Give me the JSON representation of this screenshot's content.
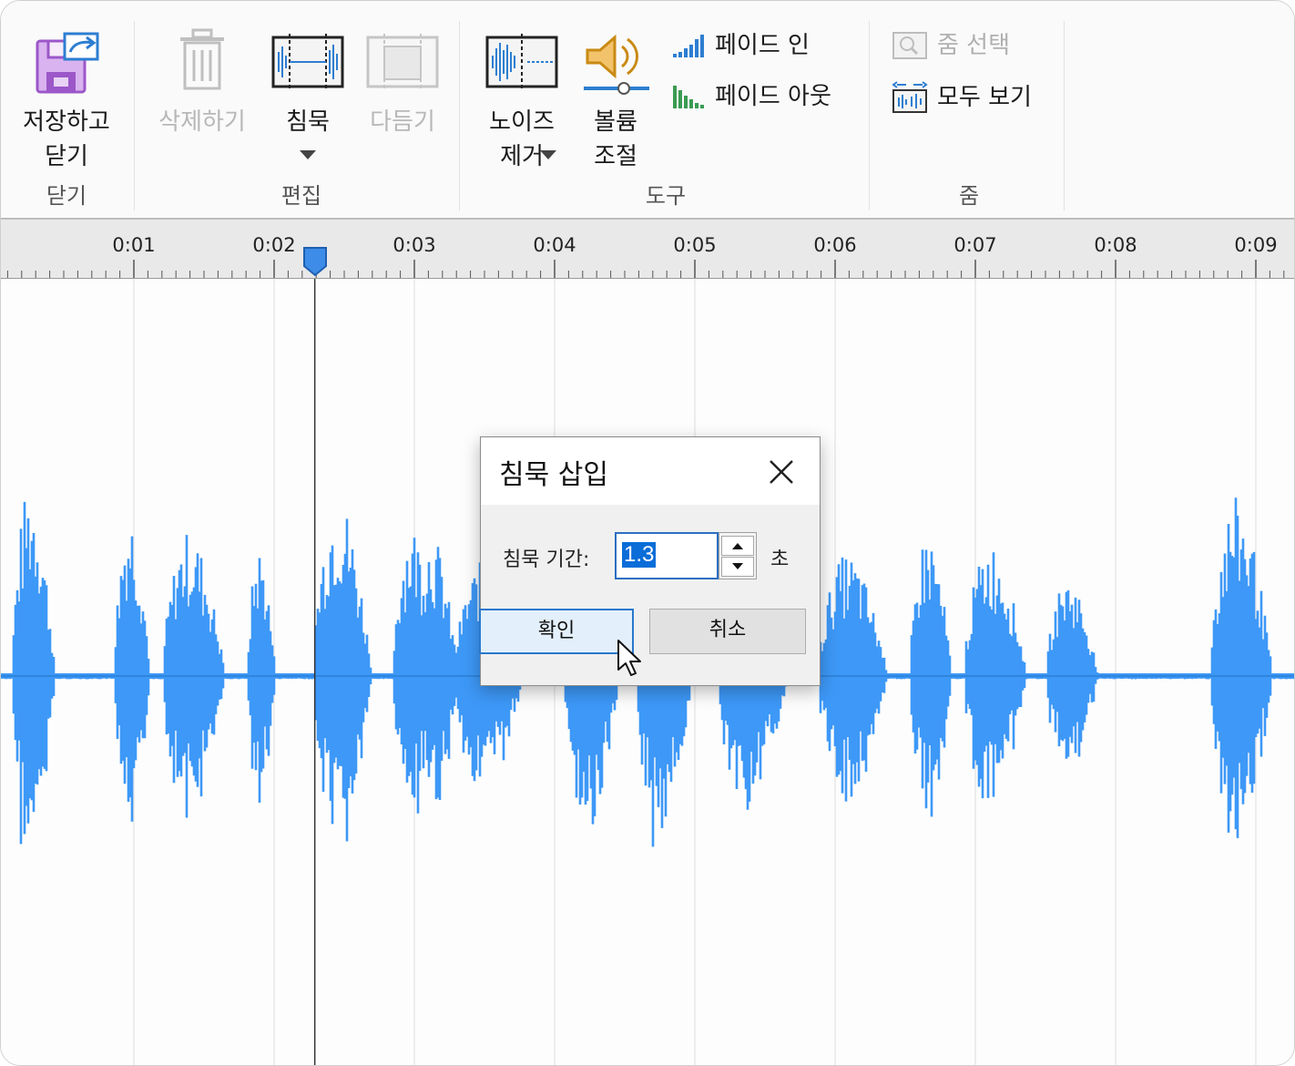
{
  "ribbon": {
    "groups": [
      {
        "label": "닫기"
      },
      {
        "label": "편집"
      },
      {
        "label": "도구"
      },
      {
        "label": "줌"
      }
    ],
    "buttons": {
      "save_close": {
        "label": "저장하고\n닫기",
        "icon": "save-close-icon",
        "enabled": true
      },
      "delete": {
        "label": "삭제하기",
        "icon": "trash-icon",
        "enabled": false
      },
      "silence": {
        "label": "침묵",
        "icon": "insert-silence-icon",
        "enabled": true,
        "has_dropdown": true
      },
      "trim": {
        "label": "다듬기",
        "icon": "trim-icon",
        "enabled": false
      },
      "noise": {
        "label": "노이즈\n제거",
        "icon": "noise-removal-icon",
        "enabled": true,
        "has_dropdown": true
      },
      "volume": {
        "label": "볼륨\n조절",
        "icon": "speaker-volume-icon",
        "enabled": true
      },
      "fade_in": {
        "label": "페이드 인",
        "icon": "fade-in-icon",
        "enabled": true
      },
      "fade_out": {
        "label": "페이드 아웃",
        "icon": "fade-out-icon",
        "enabled": true
      },
      "zoom_selection": {
        "label": "줌 선택",
        "icon": "zoom-selection-icon",
        "enabled": false
      },
      "view_all": {
        "label": "모두 보기",
        "icon": "view-all-icon",
        "enabled": true
      }
    }
  },
  "timeline": {
    "tick_labels": [
      "0:01",
      "0:02",
      "0:03",
      "0:04",
      "0:05",
      "0:06",
      "0:07",
      "0:08",
      "0:09"
    ],
    "playhead_time_s": 2.29
  },
  "colors": {
    "waveform": "#3d98f7",
    "accent": "#2a78cc",
    "playhead": "#3d8de8"
  },
  "dialog": {
    "title": "침묵 삽입",
    "duration_label": "침묵 기간:",
    "duration_value": "1.3",
    "unit": "초",
    "ok_label": "확인",
    "cancel_label": "취소"
  }
}
